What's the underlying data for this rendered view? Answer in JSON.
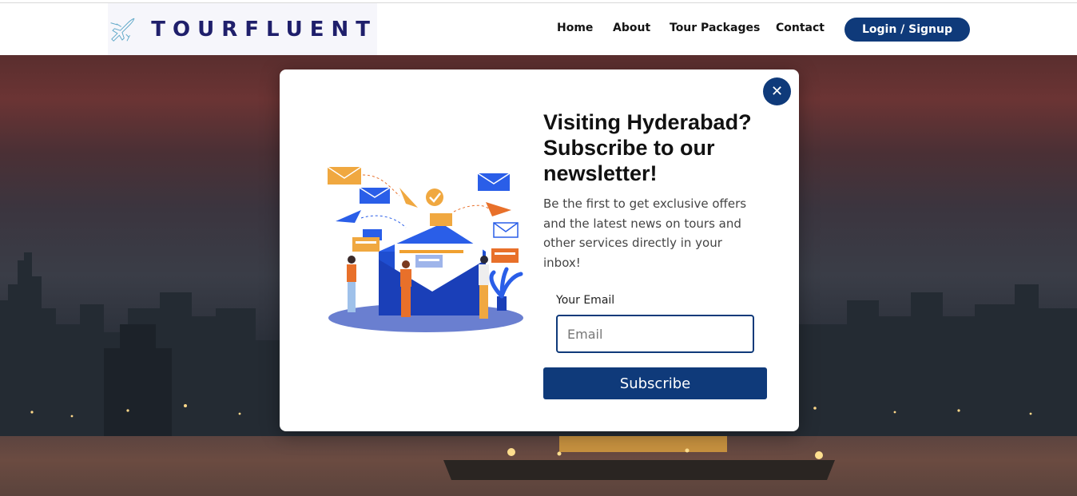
{
  "brand": {
    "name": "TOURFLUENT",
    "logo_icon": "airplane-icon"
  },
  "nav": {
    "items": [
      {
        "label": "Home"
      },
      {
        "label": "About"
      },
      {
        "label": "Tour Packages"
      },
      {
        "label": "Contact"
      }
    ],
    "login_label": "Login / Signup"
  },
  "colors": {
    "primary": "#0f3a7a",
    "brand_text": "#1f1f6b"
  },
  "modal": {
    "close_icon": "close-icon",
    "illustration": "newsletter-envelope-illustration",
    "title": "Visiting Hyderabad? Subscribe to our newsletter!",
    "text": "Be the first to get exclusive offers and the latest news on tours and other services directly in your inbox!",
    "email_label": "Your Email",
    "email_placeholder": "Email",
    "email_value": "",
    "subscribe_label": "Subscribe"
  }
}
